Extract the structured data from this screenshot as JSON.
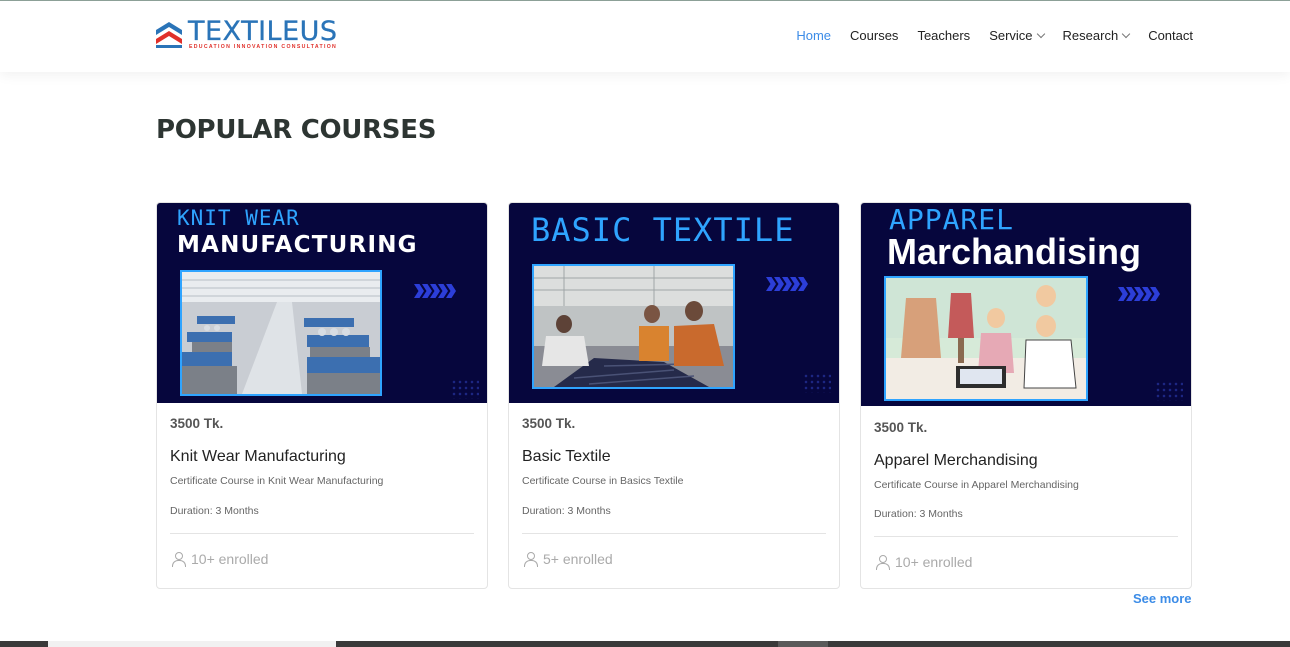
{
  "brand": {
    "name": "TEXTILEUS",
    "tagline": "EDUCATION INNOVATION CONSULTATION",
    "colors": {
      "blue": "#2a74b8",
      "red": "#e0302a"
    }
  },
  "nav": {
    "items": [
      {
        "label": "Home",
        "active": true,
        "dropdown": false
      },
      {
        "label": "Courses",
        "active": false,
        "dropdown": false
      },
      {
        "label": "Teachers",
        "active": false,
        "dropdown": false
      },
      {
        "label": "Service",
        "active": false,
        "dropdown": true
      },
      {
        "label": "Research",
        "active": false,
        "dropdown": true
      },
      {
        "label": "Contact",
        "active": false,
        "dropdown": false
      }
    ],
    "active_color": "#3c8ce7"
  },
  "section": {
    "title": "POPULAR COURSES"
  },
  "courses": [
    {
      "banner_line1": "KNIT WEAR",
      "banner_line2": "MANUFACTURING",
      "price": "3500 Tk.",
      "title": "Knit Wear Manufacturing",
      "description": "Certificate Course in Knit Wear Manufacturing",
      "duration": "Duration: 3 Months",
      "enrolled": "10+ enrolled"
    },
    {
      "banner_line1": "BASIC TEXTILE",
      "price": "3500 Tk.",
      "title": "Basic Textile",
      "description": "Certificate Course in Basics Textile",
      "duration": "Duration: 3 Months",
      "enrolled": "5+ enrolled"
    },
    {
      "banner_line1": "APPAREL",
      "banner_line2": "Marchandising",
      "price": "3500 Tk.",
      "title": "Apparel Merchandising",
      "description": "Certificate Course in Apparel Merchandising",
      "duration": "Duration: 3 Months",
      "enrolled": "10+ enrolled"
    }
  ],
  "see_more": "See more",
  "banner_colors": {
    "background": "#06063d",
    "accent": "#2fa4ff",
    "arrows": "#2c3ed8"
  }
}
